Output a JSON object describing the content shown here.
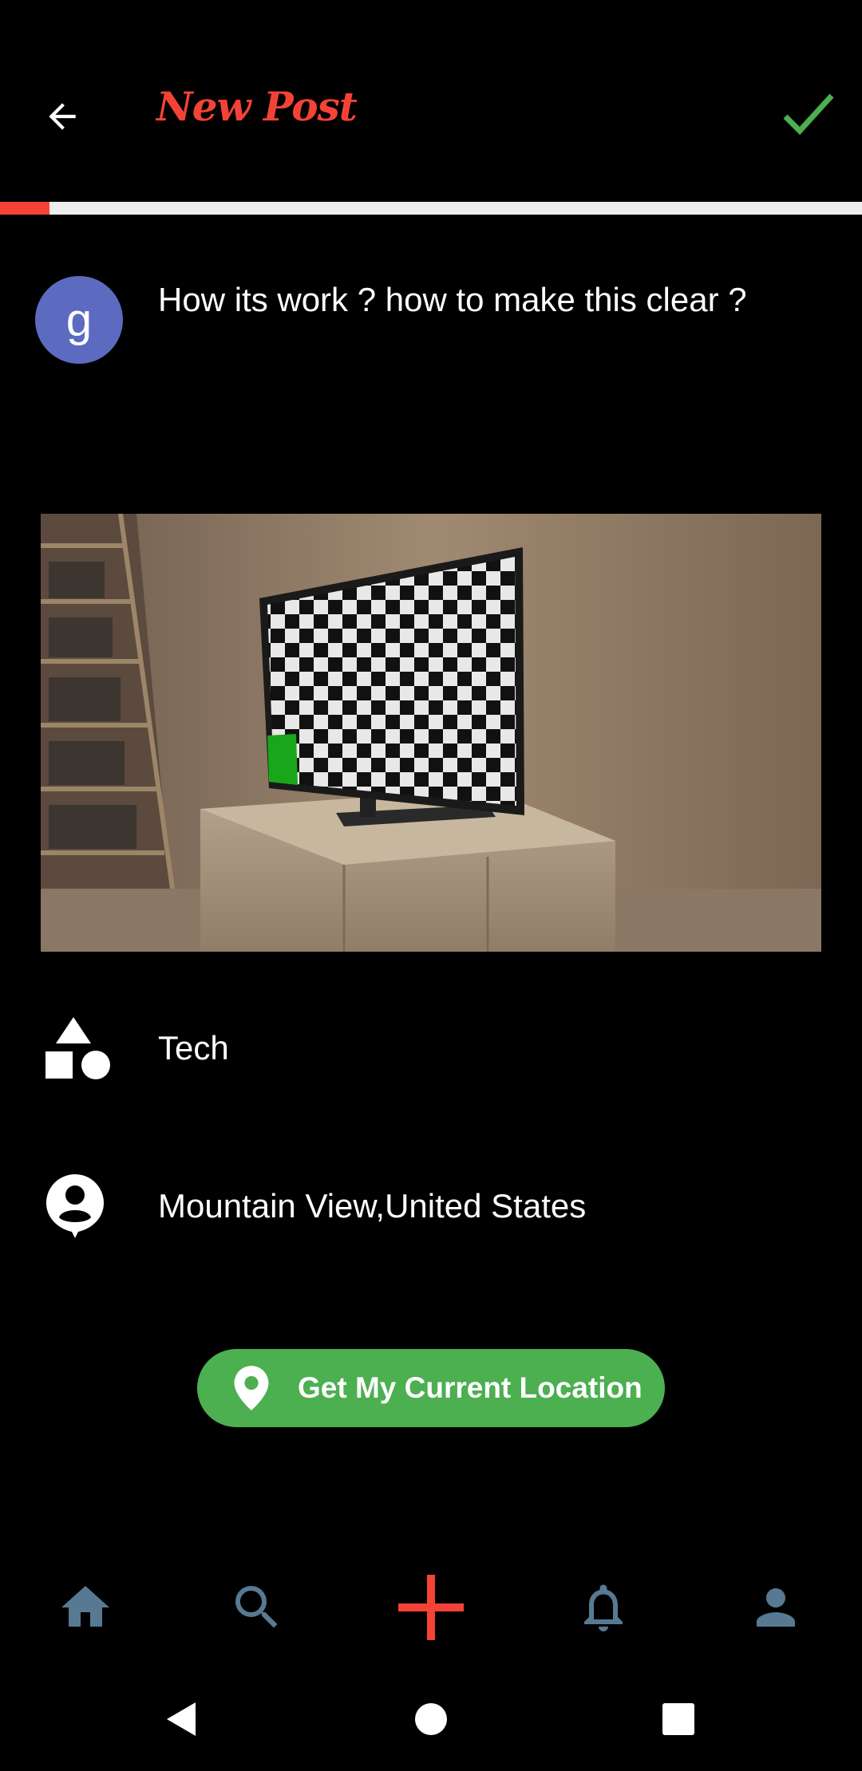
{
  "header": {
    "title": "New Post",
    "back_icon": "arrow-left-icon",
    "confirm_icon": "check-icon",
    "accent_color": "#f44336",
    "confirm_color": "#4caf50"
  },
  "progress": {
    "value_fraction": 0.057
  },
  "post": {
    "avatar_initial": "g",
    "avatar_color": "#5c6bc0",
    "text": "How its work ? how to make this clear ?"
  },
  "category": {
    "icon": "shapes-icon",
    "label": "Tech"
  },
  "location": {
    "icon": "person-pin-icon",
    "label": "Mountain View,United States"
  },
  "location_button": {
    "icon": "location-pin-icon",
    "label": "Get My Current Location",
    "color": "#4caf50"
  },
  "bottom_nav": {
    "items": [
      {
        "icon": "home-icon"
      },
      {
        "icon": "search-icon"
      },
      {
        "icon": "add-icon"
      },
      {
        "icon": "bell-icon"
      },
      {
        "icon": "person-icon"
      }
    ],
    "icon_color": "#577a92",
    "active_color": "#f44336"
  },
  "system_nav": {
    "items": [
      {
        "icon": "back-triangle-icon"
      },
      {
        "icon": "home-circle-icon"
      },
      {
        "icon": "recents-square-icon"
      }
    ]
  }
}
